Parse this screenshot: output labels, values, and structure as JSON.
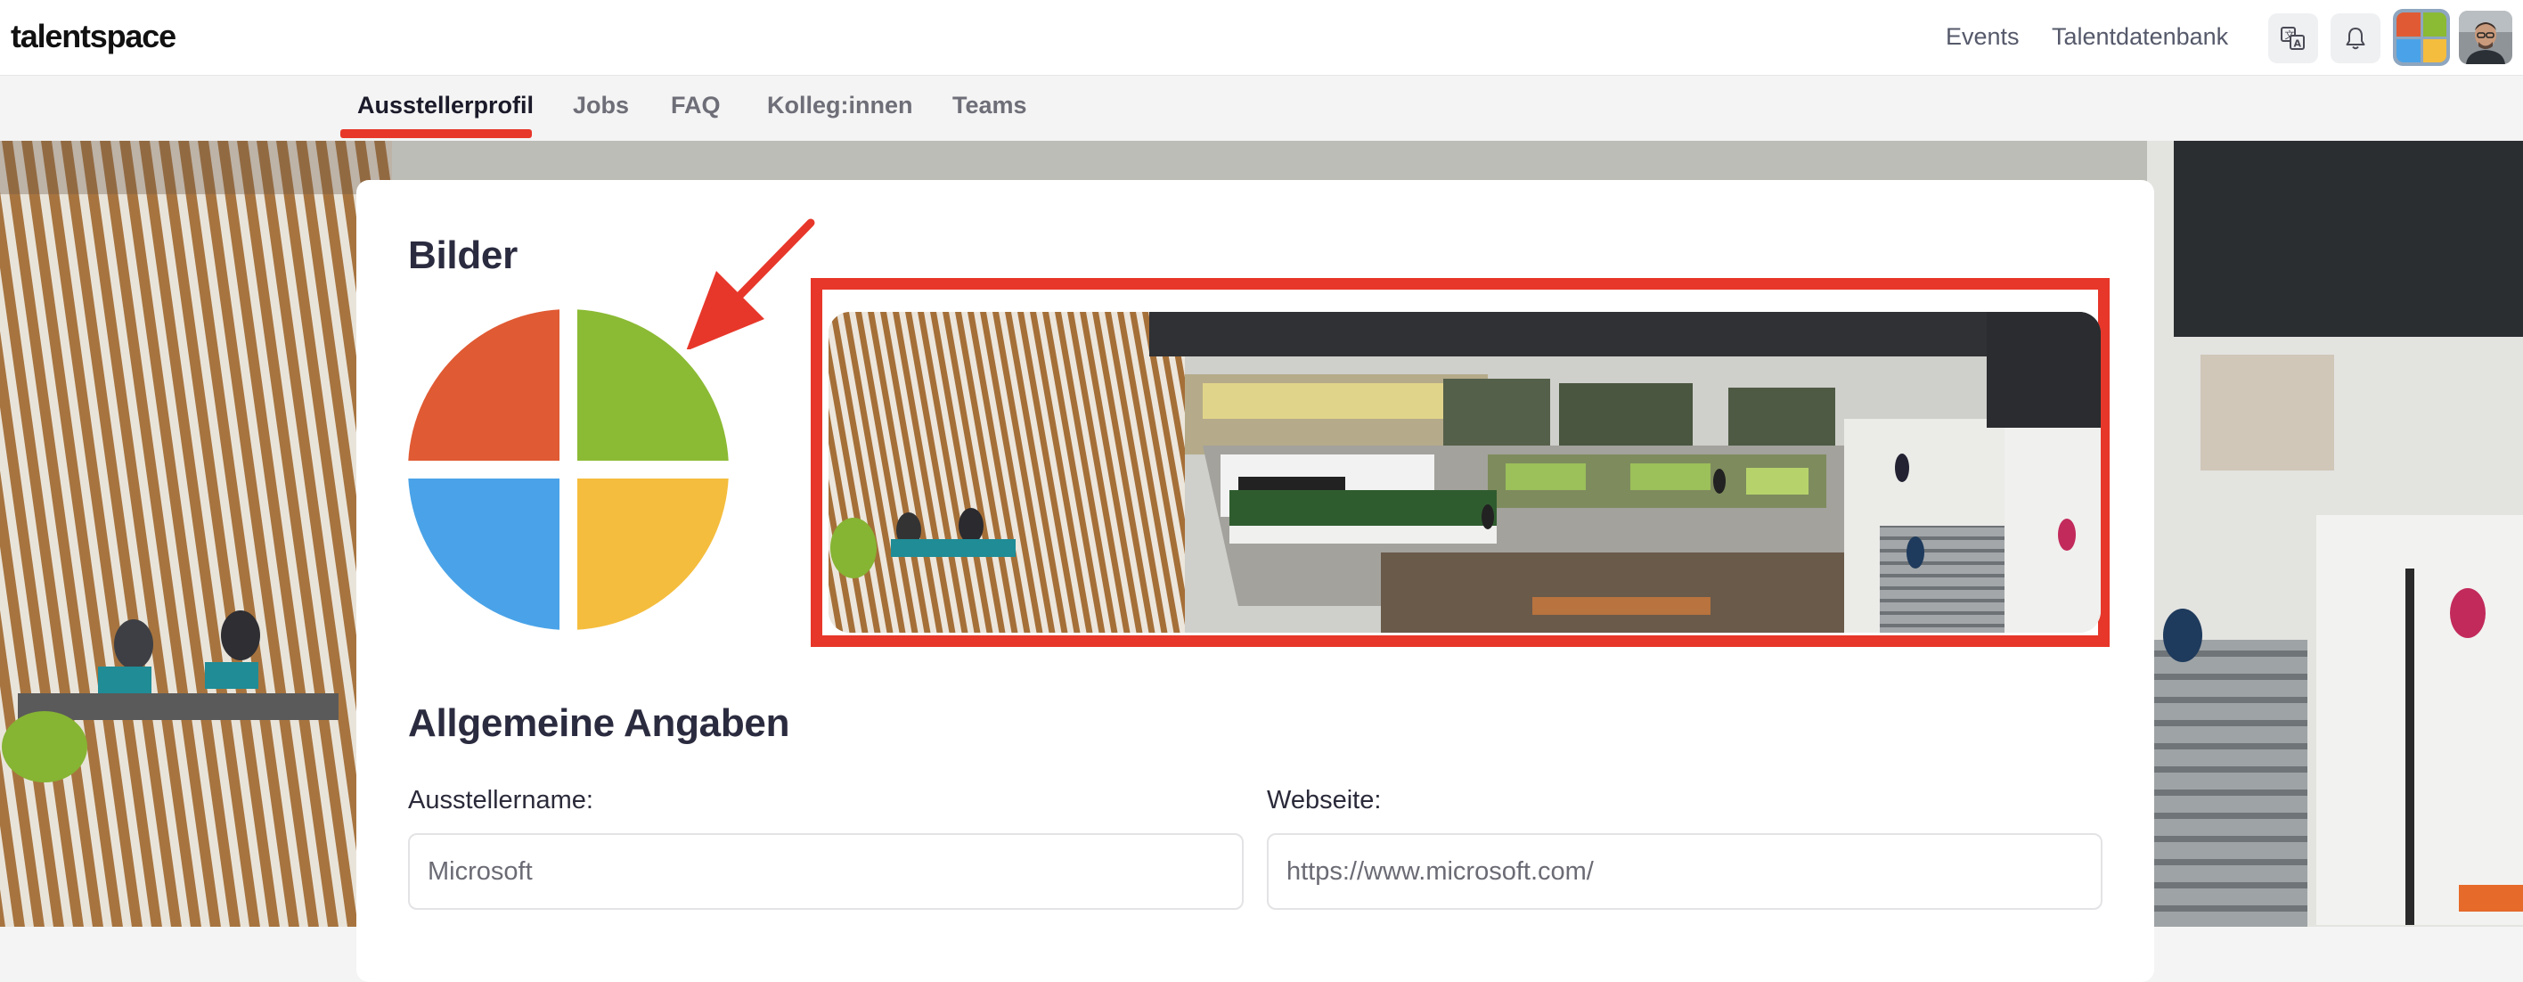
{
  "app": {
    "logo_text": "talentspace",
    "nav_links": {
      "events": "Events",
      "talent_db": "Talentdatenbank"
    }
  },
  "tabs": [
    {
      "label": "Ausstellerprofil",
      "active": true
    },
    {
      "label": "Jobs",
      "active": false
    },
    {
      "label": "FAQ",
      "active": false
    },
    {
      "label": "Kolleg:innen",
      "active": false
    },
    {
      "label": "Teams",
      "active": false
    }
  ],
  "icons": {
    "translate": "translate-icon",
    "notifications": "bell-icon",
    "company": "microsoft-logo",
    "user": "user-avatar"
  },
  "profile": {
    "images_title": "Bilder",
    "general_title": "Allgemeine Angaben",
    "fields": {
      "exhibitor_name": {
        "label": "Ausstellername:",
        "value": "Microsoft"
      },
      "website": {
        "label": "Webseite:",
        "value": "https://www.microsoft.com/"
      }
    }
  },
  "colors": {
    "accent_red": "#e7372a",
    "logo_red": "#e05a33",
    "logo_green": "#8bba34",
    "logo_blue": "#4aa3e8",
    "logo_yellow": "#f5bd3d"
  }
}
